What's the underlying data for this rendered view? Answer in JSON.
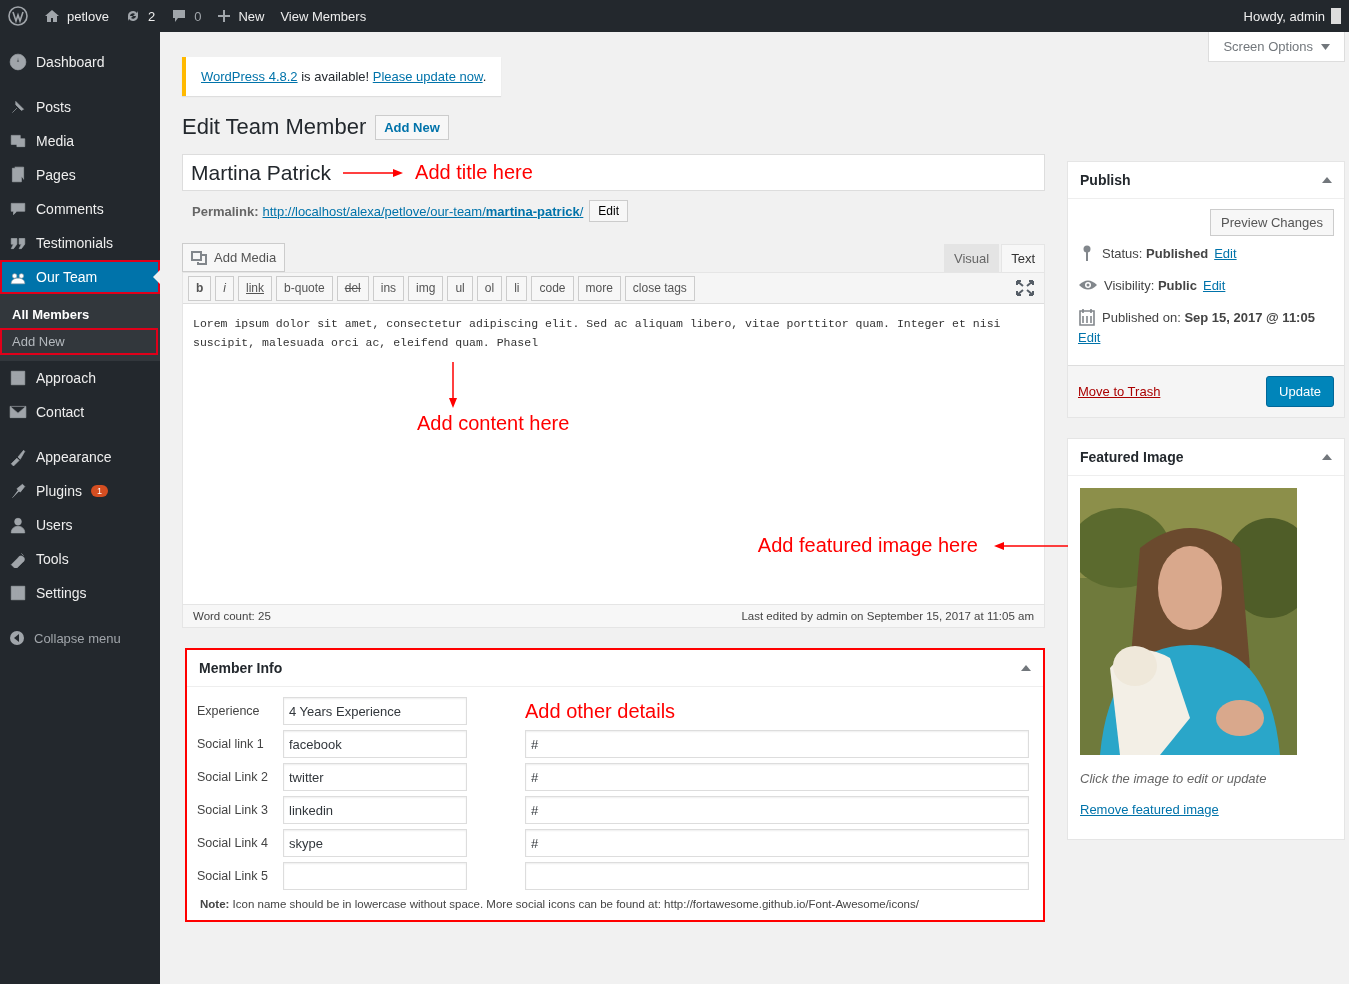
{
  "admin_bar": {
    "site": "petlove",
    "updates": "2",
    "comments": "0",
    "new": "New",
    "view": "View Members",
    "howdy": "Howdy, admin"
  },
  "sidebar": {
    "groups": [
      [
        {
          "label": "Dashboard",
          "selected": false,
          "highlighted": false
        }
      ],
      [
        {
          "label": "Posts",
          "selected": false,
          "highlighted": false
        },
        {
          "label": "Media",
          "selected": false,
          "highlighted": false
        },
        {
          "label": "Pages",
          "selected": false,
          "highlighted": false
        },
        {
          "label": "Comments",
          "selected": false,
          "highlighted": false
        },
        {
          "label": "Testimonials",
          "selected": false,
          "highlighted": false
        },
        {
          "label": "Our Team",
          "selected": true,
          "highlighted": true,
          "children": [
            {
              "label": "All Members",
              "selected": true,
              "highlighted": false
            },
            {
              "label": "Add New",
              "selected": false,
              "highlighted": true
            }
          ]
        },
        {
          "label": "Approach",
          "selected": false,
          "highlighted": false
        },
        {
          "label": "Contact",
          "selected": false,
          "highlighted": false
        }
      ],
      [
        {
          "label": "Appearance",
          "selected": false,
          "highlighted": false
        },
        {
          "label": "Plugins",
          "selected": false,
          "highlighted": false,
          "badge": "1"
        },
        {
          "label": "Users",
          "selected": false,
          "highlighted": false
        },
        {
          "label": "Tools",
          "selected": false,
          "highlighted": false
        },
        {
          "label": "Settings",
          "selected": false,
          "highlighted": false
        }
      ]
    ],
    "collapse": "Collapse menu"
  },
  "screen_options": "Screen Options",
  "notice": {
    "parts": [
      {
        "text": "WordPress 4.8.2",
        "link": true
      },
      {
        "text": " is available! ",
        "link": false
      },
      {
        "text": "Please update now",
        "link": true
      },
      {
        "text": ".",
        "link": false
      }
    ]
  },
  "heading": {
    "title": "Edit Team Member",
    "add_new": "Add New"
  },
  "post_title": {
    "value": "Martina Patrick",
    "annotation": "Add title here"
  },
  "permalink": {
    "label": "Permalink:",
    "url": "http://localhost/alexa/petlove/our-team/**martina-patrick**/",
    "edit": "Edit"
  },
  "editor": {
    "add_media": "Add Media",
    "tabs": [
      {
        "label": "Visual",
        "selected": false
      },
      {
        "label": "Text",
        "selected": true
      }
    ],
    "toolbar": [
      {
        "label": "b",
        "kind": "bold"
      },
      {
        "label": "i",
        "kind": "italic"
      },
      {
        "label": "link",
        "kind": "underline"
      },
      {
        "label": "b-quote",
        "kind": "plain"
      },
      {
        "label": "del",
        "kind": "strike"
      },
      {
        "label": "ins",
        "kind": "plain"
      },
      {
        "label": "img",
        "kind": "plain"
      },
      {
        "label": "ul",
        "kind": "plain"
      },
      {
        "label": "ol",
        "kind": "plain"
      },
      {
        "label": "li",
        "kind": "plain"
      },
      {
        "label": "code",
        "kind": "plain"
      },
      {
        "label": "more",
        "kind": "plain"
      },
      {
        "label": "close tags",
        "kind": "plain"
      }
    ],
    "content": "Lorem ipsum dolor sit amet, consectetur adipiscing elit. Sed ac aliquam libero, vitae porttitor quam. Integer et nisi suscipit, malesuada orci ac, eleifend quam. Phasel",
    "content_annotation": "Add content here",
    "image_annotation": "Add featured image here",
    "word_count": "Word count: 25",
    "last_edited": "Last edited by admin on September 15, 2017 at 11:05 am"
  },
  "member_info": {
    "title": "Member Info",
    "highlighted": true,
    "annotation": "Add other details",
    "rows": [
      {
        "label": "Experience",
        "value": "4 Years Experience"
      },
      {
        "label": "Social link 1",
        "value": "facebook",
        "url": "#"
      },
      {
        "label": "Social Link 2",
        "value": "twitter",
        "url": "#"
      },
      {
        "label": "Social Link 3",
        "value": "linkedin",
        "url": "#"
      },
      {
        "label": "Social Link 4",
        "value": "skype",
        "url": "#"
      },
      {
        "label": "Social Link 5",
        "show_url": true
      }
    ],
    "note": "**Note:** Icon name should be in lowercase without space. More social icons can be found at: http://fortawesome.github.io/Font-Awesome/icons/"
  },
  "publish": {
    "title": "Publish",
    "preview": "Preview Changes",
    "rows": [
      {
        "kind": "status",
        "label": "Status:",
        "value": "Published",
        "link": "Edit"
      },
      {
        "kind": "visibility",
        "label": "Visibility:",
        "value": "Public",
        "link": "Edit"
      },
      {
        "kind": "date",
        "label": "Published on:",
        "value": "Sep 15, 2017 @ 11:05",
        "link": "Edit"
      }
    ],
    "trash": "Move to Trash",
    "update": "Update"
  },
  "featured_image": {
    "title": "Featured Image",
    "hint": "Click the image to edit or update",
    "remove": "Remove featured image"
  }
}
